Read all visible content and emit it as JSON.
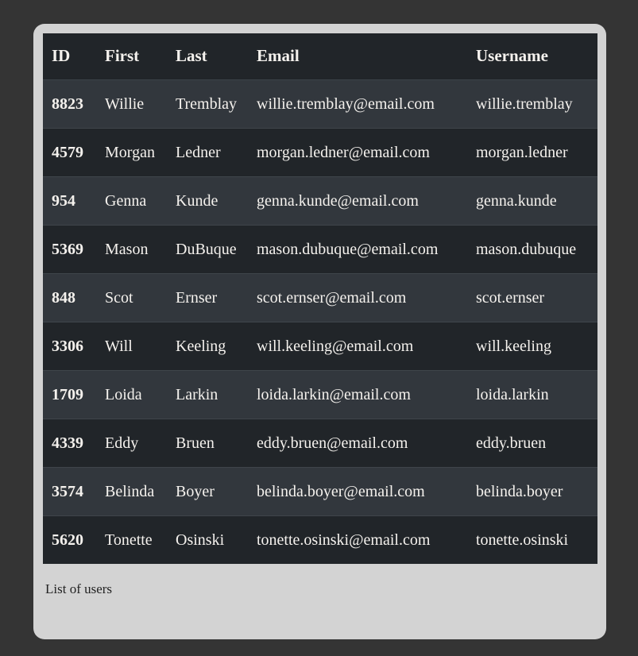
{
  "card": {
    "caption": "List of users",
    "background_color": "#d3d3d3"
  },
  "page": {
    "background_color": "#343434"
  },
  "table": {
    "header_background": "#212529",
    "stripe_color": "#32373d",
    "text_color": "#f5f2ee",
    "columns": [
      {
        "key": "id",
        "label": "ID"
      },
      {
        "key": "first",
        "label": "First"
      },
      {
        "key": "last",
        "label": "Last"
      },
      {
        "key": "email",
        "label": "Email"
      },
      {
        "key": "username",
        "label": "Username"
      }
    ],
    "rows": [
      {
        "id": "8823",
        "first": "Willie",
        "last": "Tremblay",
        "email": "willie.tremblay@email.com",
        "username": "willie.tremblay"
      },
      {
        "id": "4579",
        "first": "Morgan",
        "last": "Ledner",
        "email": "morgan.ledner@email.com",
        "username": "morgan.ledner"
      },
      {
        "id": "954",
        "first": "Genna",
        "last": "Kunde",
        "email": "genna.kunde@email.com",
        "username": "genna.kunde"
      },
      {
        "id": "5369",
        "first": "Mason",
        "last": "DuBuque",
        "email": "mason.dubuque@email.com",
        "username": "mason.dubuque"
      },
      {
        "id": "848",
        "first": "Scot",
        "last": "Ernser",
        "email": "scot.ernser@email.com",
        "username": "scot.ernser"
      },
      {
        "id": "3306",
        "first": "Will",
        "last": "Keeling",
        "email": "will.keeling@email.com",
        "username": "will.keeling"
      },
      {
        "id": "1709",
        "first": "Loida",
        "last": "Larkin",
        "email": "loida.larkin@email.com",
        "username": "loida.larkin"
      },
      {
        "id": "4339",
        "first": "Eddy",
        "last": "Bruen",
        "email": "eddy.bruen@email.com",
        "username": "eddy.bruen"
      },
      {
        "id": "3574",
        "first": "Belinda",
        "last": "Boyer",
        "email": "belinda.boyer@email.com",
        "username": "belinda.boyer"
      },
      {
        "id": "5620",
        "first": "Tonette",
        "last": "Osinski",
        "email": "tonette.osinski@email.com",
        "username": "tonette.osinski"
      }
    ]
  }
}
